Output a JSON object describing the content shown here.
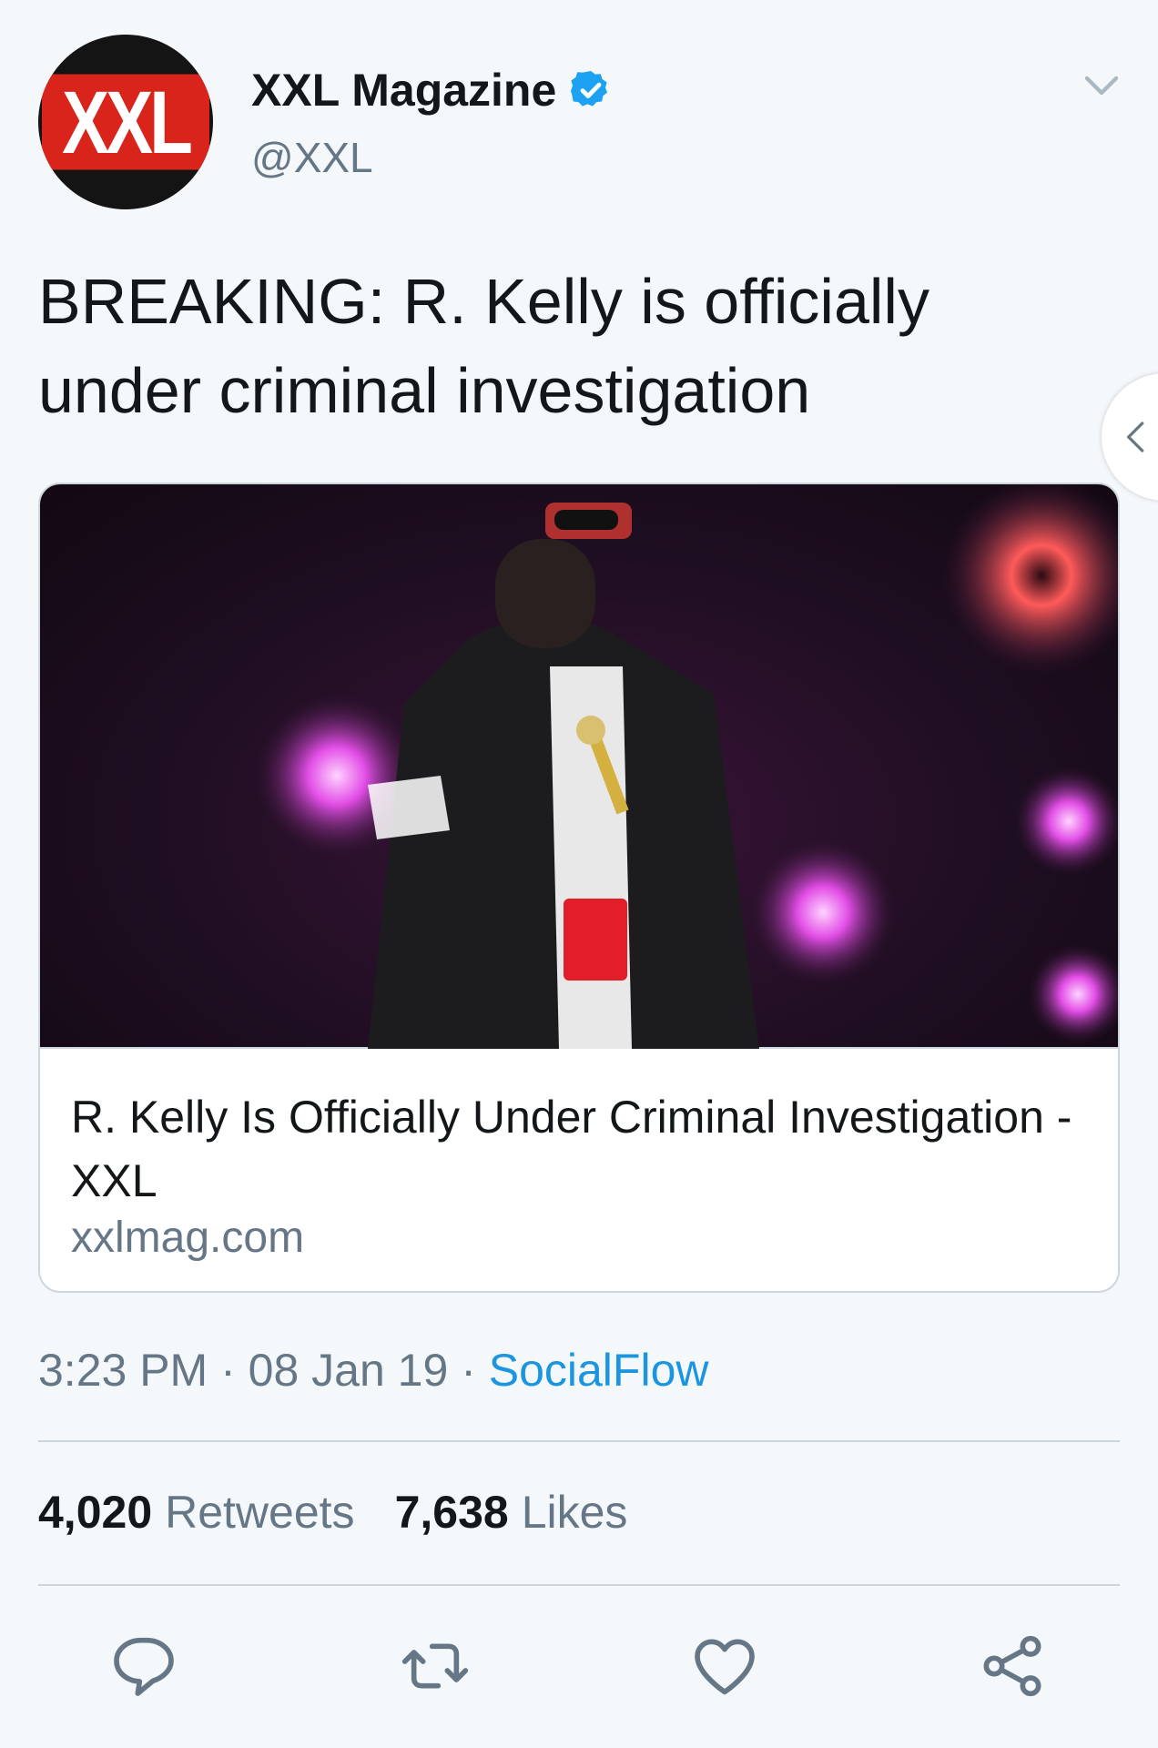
{
  "author": {
    "avatar_text": "XXL",
    "display_name": "XXL Magazine",
    "handle": "@XXL",
    "verified_icon": "verified-badge-icon"
  },
  "tweet": {
    "text": "BREAKING: R. Kelly is officially under criminal investigation"
  },
  "card": {
    "title": "R. Kelly Is Officially Under Criminal Investigation - XXL",
    "domain": "xxlmag.com"
  },
  "meta": {
    "time": "3:23 PM",
    "separator": " · ",
    "date": "08 Jan 19",
    "source": "SocialFlow"
  },
  "stats": {
    "retweets_count": "4,020",
    "retweets_label": "Retweets",
    "likes_count": "7,638",
    "likes_label": "Likes"
  },
  "actions": [
    "reply-icon",
    "retweet-icon",
    "like-icon",
    "share-icon"
  ],
  "colors": {
    "link": "#1b95e0",
    "secondary_text": "#657786",
    "primary_text": "#14171a",
    "background": "#f5f8fa",
    "brand_red": "#d9241c"
  }
}
